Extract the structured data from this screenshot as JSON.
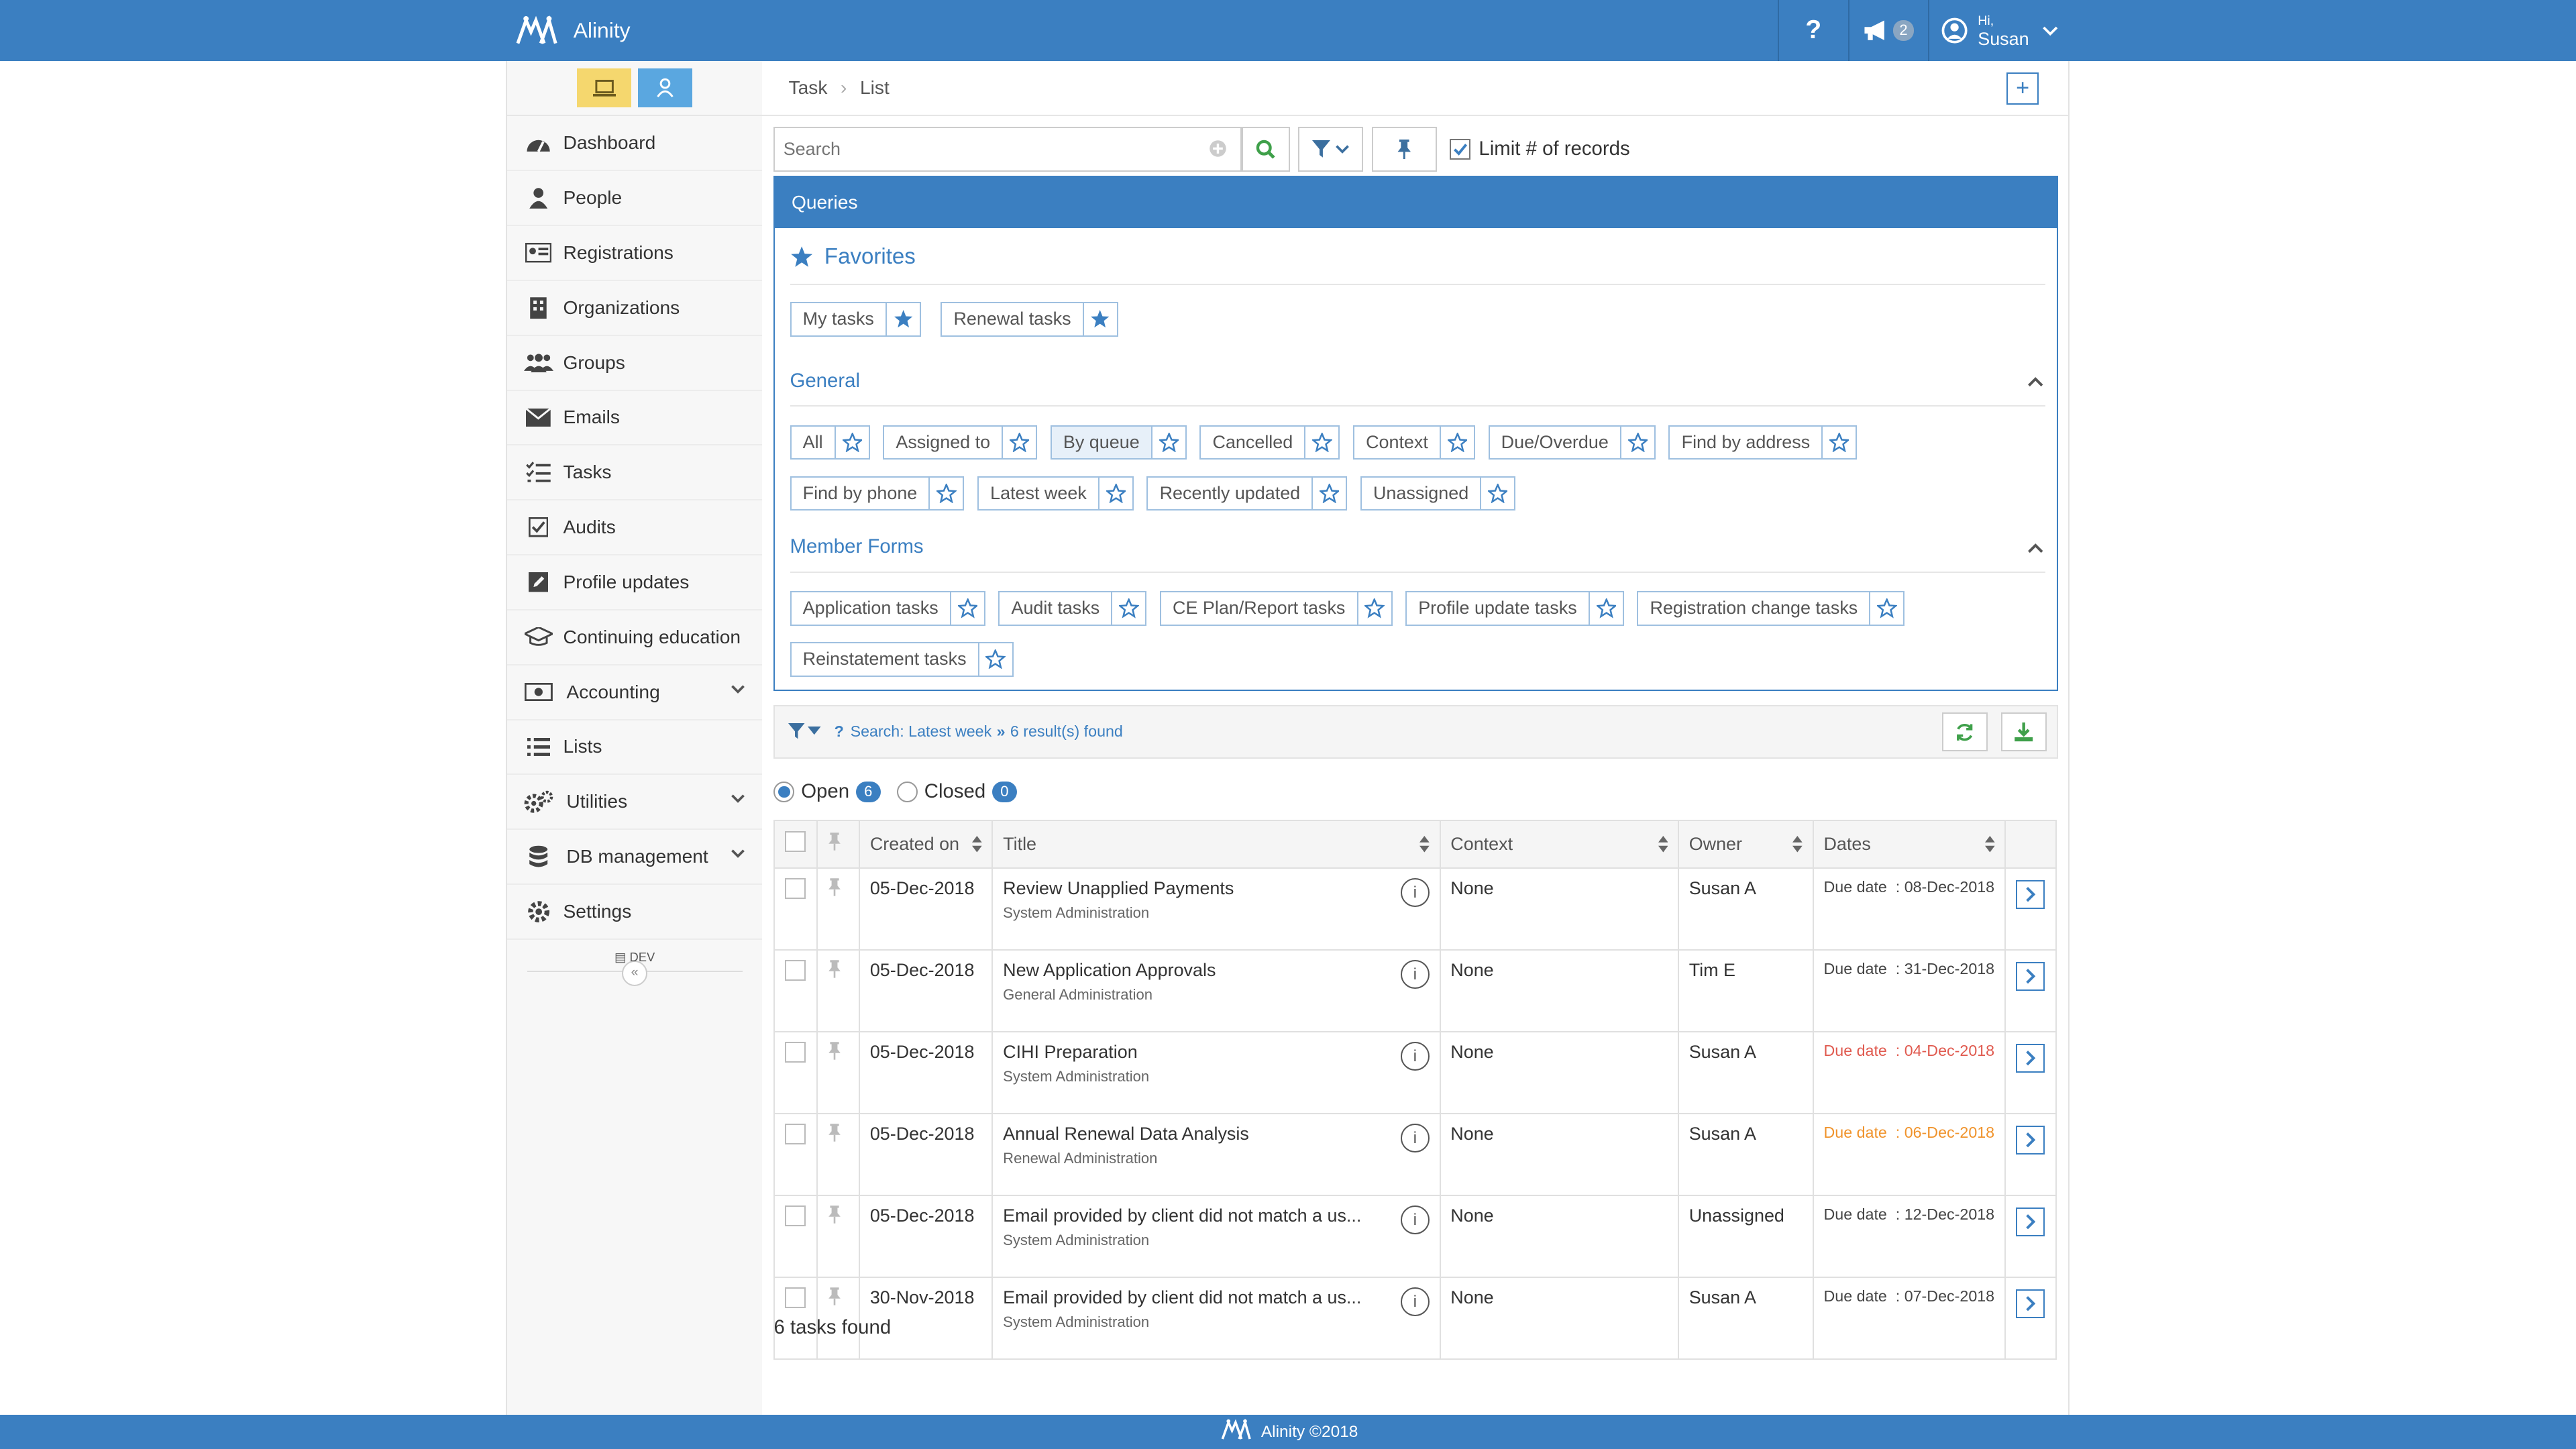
{
  "app": {
    "name": "Alinity",
    "notifications": "2",
    "greeting": "Hi,",
    "user": "Susan",
    "footer": "Alinity ©2018"
  },
  "sidebar": {
    "items": [
      {
        "label": "Dashboard",
        "icon": "dashboard-icon"
      },
      {
        "label": "People",
        "icon": "person-icon"
      },
      {
        "label": "Registrations",
        "icon": "id-card-icon"
      },
      {
        "label": "Organizations",
        "icon": "building-icon"
      },
      {
        "label": "Groups",
        "icon": "group-icon"
      },
      {
        "label": "Emails",
        "icon": "envelope-icon"
      },
      {
        "label": "Tasks",
        "icon": "tasks-icon"
      },
      {
        "label": "Audits",
        "icon": "checkbox-icon"
      },
      {
        "label": "Profile updates",
        "icon": "edit-icon"
      },
      {
        "label": "Continuing education",
        "icon": "graduation-cap-icon"
      },
      {
        "label": "Accounting",
        "icon": "money-icon"
      },
      {
        "label": "Lists",
        "icon": "list-icon"
      },
      {
        "label": "Utilities",
        "icon": "cogs-icon"
      },
      {
        "label": "DB management",
        "icon": "database-icon"
      },
      {
        "label": "Settings",
        "icon": "gear-icon"
      }
    ],
    "dev_label": "DEV",
    "collapse": "«"
  },
  "breadcrumb": {
    "first": "Task",
    "second": "List"
  },
  "search": {
    "placeholder": "Search",
    "limit_label": "Limit # of records"
  },
  "queries": {
    "title": "Queries",
    "favorites_title": "Favorites",
    "favorites": [
      "My tasks",
      "Renewal tasks"
    ],
    "general_title": "General",
    "general_row1": [
      "All",
      "Assigned to",
      "By queue",
      "Cancelled",
      "Context",
      "Due/Overdue",
      "Find by address"
    ],
    "general_row2": [
      "Find by phone",
      "Latest week",
      "Recently updated",
      "Unassigned"
    ],
    "member_title": "Member Forms",
    "member_row1": [
      "Application tasks",
      "Audit tasks",
      "CE Plan/Report tasks",
      "Profile update tasks",
      "Registration change tasks"
    ],
    "member_row2": [
      "Reinstatement tasks"
    ]
  },
  "results": {
    "search_prefix": "?",
    "search_text": "Search: Latest week",
    "found_text": "6 result(s) found"
  },
  "status": {
    "open_label": "Open",
    "open_count": "6",
    "closed_label": "Closed",
    "closed_count": "0"
  },
  "table": {
    "columns": {
      "created": "Created on",
      "title": "Title",
      "context": "Context",
      "owner": "Owner",
      "dates": "Dates"
    },
    "due_label": "Due date",
    "rows": [
      {
        "created": "05-Dec-2018",
        "title": "Review Unapplied Payments",
        "sub": "System Administration",
        "context": "None",
        "owner": "Susan A",
        "due": ": 08-Dec-2018",
        "due_color": ""
      },
      {
        "created": "05-Dec-2018",
        "title": "New Application Approvals",
        "sub": "General Administration",
        "context": "None",
        "owner": "Tim E",
        "due": ": 31-Dec-2018",
        "due_color": ""
      },
      {
        "created": "05-Dec-2018",
        "title": "CIHI Preparation",
        "sub": "System Administration",
        "context": "None",
        "owner": "Susan A",
        "due": ": 04-Dec-2018",
        "due_color": "red"
      },
      {
        "created": "05-Dec-2018",
        "title": "Annual Renewal Data Analysis",
        "sub": "Renewal Administration",
        "context": "None",
        "owner": "Susan A",
        "due": ": 06-Dec-2018",
        "due_color": "orange"
      },
      {
        "created": "05-Dec-2018",
        "title": "Email provided by client did not match a us...",
        "sub": "System Administration",
        "context": "None",
        "owner": "Unassigned",
        "due": ": 12-Dec-2018",
        "due_color": ""
      },
      {
        "created": "30-Nov-2018",
        "title": "Email provided by client did not match a us...",
        "sub": "System Administration",
        "context": "None",
        "owner": "Susan A",
        "due": ": 07-Dec-2018",
        "due_color": ""
      }
    ]
  },
  "summary": {
    "found": "6 tasks found"
  },
  "colors": {
    "primary": "#3b7fc1",
    "danger": "#e05a4f",
    "warning": "#f0932b",
    "toggle_yellow": "#f5d76e",
    "toggle_blue": "#5aa7e0"
  }
}
